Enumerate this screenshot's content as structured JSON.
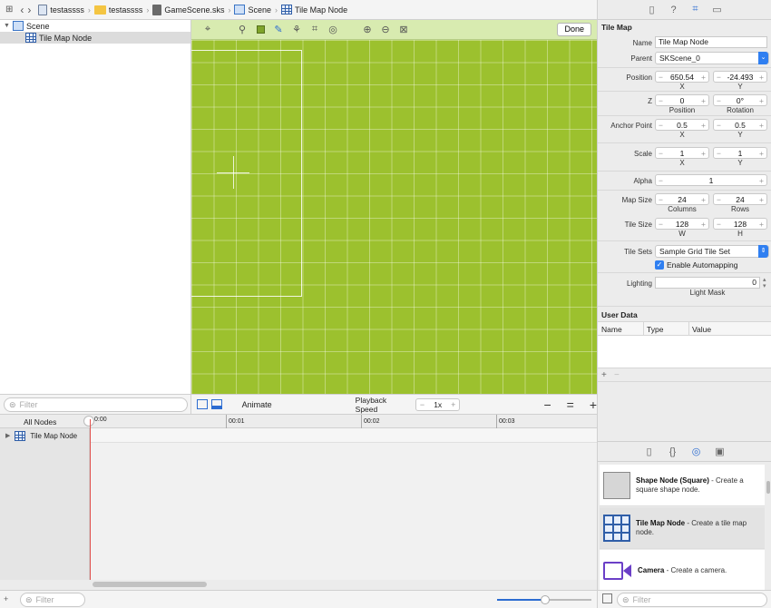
{
  "breadcrumb": {
    "items": [
      {
        "label": "testassss",
        "icon": "project-icon"
      },
      {
        "label": "testassss",
        "icon": "folder-icon"
      },
      {
        "label": "GameScene.sks",
        "icon": "sks-file-icon"
      },
      {
        "label": "Scene",
        "icon": "scene-icon"
      },
      {
        "label": "Tile Map Node",
        "icon": "tile-map-icon"
      }
    ]
  },
  "outline": {
    "items": [
      {
        "label": "Scene"
      },
      {
        "label": "Tile Map Node"
      }
    ],
    "filter_placeholder": "Filter"
  },
  "editor": {
    "done_label": "Done"
  },
  "animate_bar": {
    "animate_label": "Animate",
    "playback_speed_label": "Playback Speed",
    "speed_value": "1x"
  },
  "timeline": {
    "filter_label": "All Nodes",
    "ticks": [
      "0:00",
      "00:01",
      "00:02",
      "00:03"
    ],
    "track_label": "Tile Map Node"
  },
  "bottom_filter_placeholder": "Filter",
  "inspector": {
    "section_title": "Tile Map",
    "name_label": "Name",
    "name_value": "Tile Map Node",
    "parent_label": "Parent",
    "parent_value": "SKScene_0",
    "position_label": "Position",
    "position_x": "650.54",
    "position_y": "-24.493",
    "x_label": "X",
    "y_label": "Y",
    "z_label": "Z",
    "z_value": "0",
    "rotation_value": "0°",
    "z_position_sub": "Position",
    "rotation_sub": "Rotation",
    "anchor_label": "Anchor Point",
    "anchor_x": "0.5",
    "anchor_y": "0.5",
    "scale_label": "Scale",
    "scale_x": "1",
    "scale_y": "1",
    "alpha_label": "Alpha",
    "alpha_value": "1",
    "map_size_label": "Map Size",
    "map_columns": "24",
    "map_rows": "24",
    "columns_sub": "Columns",
    "rows_sub": "Rows",
    "tile_size_label": "Tile Size",
    "tile_w": "128",
    "tile_h": "128",
    "w_sub": "W",
    "h_sub": "H",
    "tile_sets_label": "Tile Sets",
    "tile_sets_value": "Sample Grid Tile Set",
    "automapping_label": "Enable Automapping",
    "automapping_checked": true,
    "lighting_label": "Lighting",
    "lighting_value": "0",
    "light_mask_sub": "Light Mask",
    "user_data_title": "User Data",
    "user_data_columns": [
      "Name",
      "Type",
      "Value"
    ]
  },
  "library": {
    "items": [
      {
        "title": "Shape Node (Square)",
        "desc": " - Create a square shape node."
      },
      {
        "title": "Tile Map Node",
        "desc": " - Create a tile map node."
      },
      {
        "title": "Camera",
        "desc": " - Create a camera."
      }
    ],
    "filter_placeholder": "Filter"
  },
  "colors": {
    "accent": "#2c6cd1",
    "canvas_green": "#9cc12e",
    "toolbar_green": "#d8ebb0",
    "playhead": "#e0524f"
  }
}
